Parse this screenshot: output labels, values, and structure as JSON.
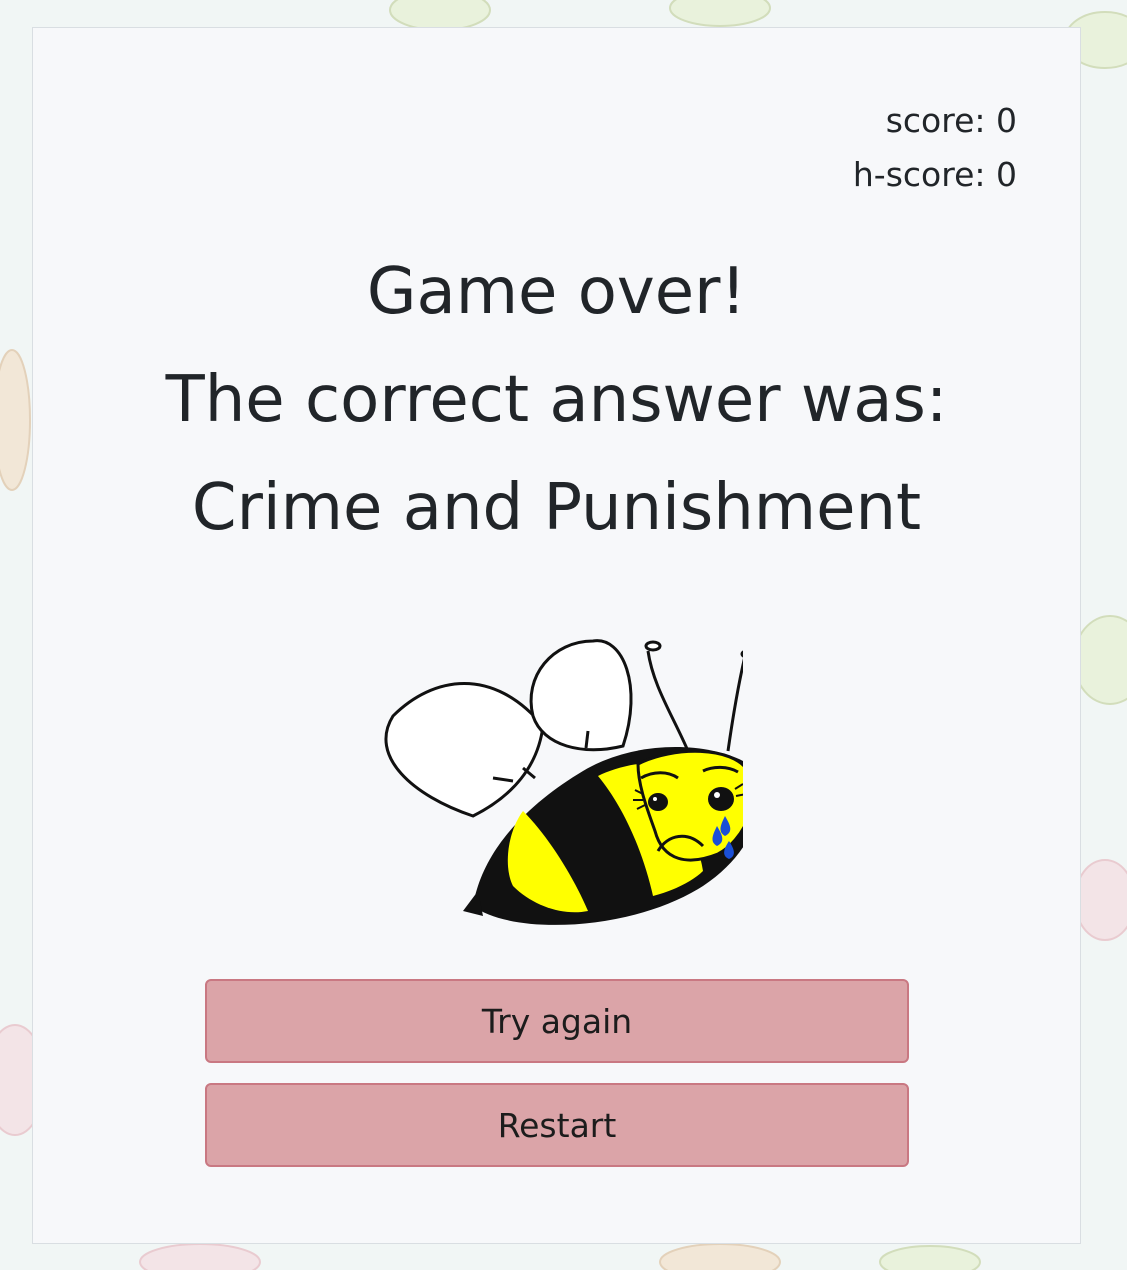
{
  "scoreboard": {
    "score_text": "score: 0",
    "high_score_text": "h-score: 0"
  },
  "result": {
    "line1": "Game over!",
    "line2": "The correct answer was:",
    "answer": "Crime and Punishment"
  },
  "illustration": {
    "icon": "crying-bee",
    "colors": {
      "body_yellow": "#ffff00",
      "stripe": "#111111",
      "tear": "#1a4fd6"
    }
  },
  "buttons": {
    "try_again_label": "Try again",
    "restart_label": "Restart",
    "color": "#dba4a8",
    "border_color": "#c97882"
  },
  "colors": {
    "page_background": "#f1f6f5",
    "card_background": "#f7f8fa",
    "text": "#212529"
  }
}
